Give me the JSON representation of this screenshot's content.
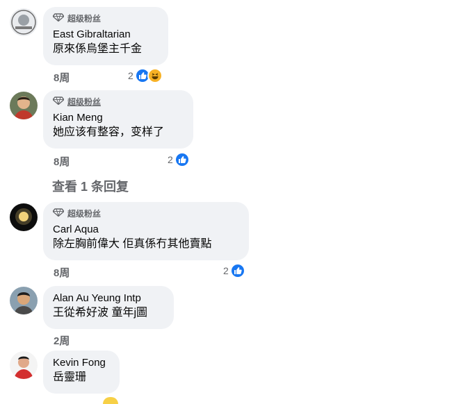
{
  "comments": [
    {
      "badge": "超级粉丝",
      "name": "East Gibraltarian",
      "text": "原來係烏堡主千金",
      "time": "8周",
      "reaction_count": "2",
      "reactions": [
        "like-icon",
        "haha-icon"
      ]
    },
    {
      "badge": "超级粉丝",
      "name": "Kian Meng",
      "text": "她应该有整容，变样了",
      "time": "8周",
      "reaction_count": "2",
      "reactions": [
        "like-icon"
      ]
    },
    {
      "badge": "超级粉丝",
      "name": "Carl Aqua",
      "text": "除左胸前偉大 佢真係冇其他賣點",
      "time": "8周",
      "reaction_count": "2",
      "reactions": [
        "like-icon"
      ]
    },
    {
      "name": "Alan Au Yeung Intp",
      "text": "王從希好波 童年j圖",
      "time": "2周"
    },
    {
      "name": "Kevin Fong",
      "text": "岳靈珊"
    }
  ],
  "view_replies": "查看 1 条回复",
  "colors": {
    "bubble": "#f0f2f5",
    "like": "#1877f2",
    "haha": "#f7b125",
    "meta": "#65676b"
  }
}
